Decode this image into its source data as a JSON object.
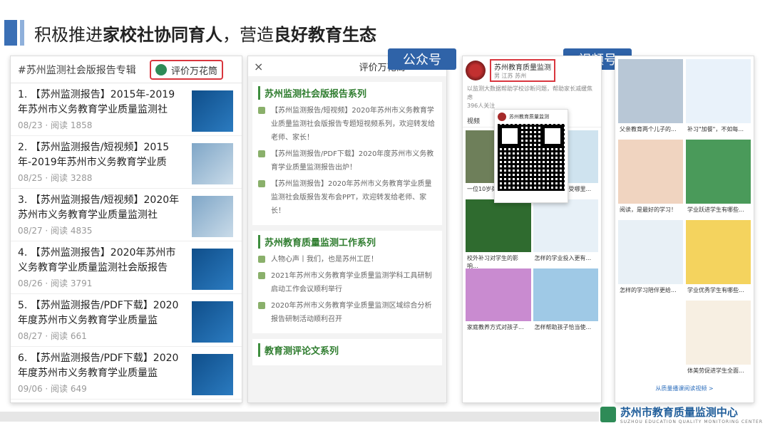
{
  "slide": {
    "title_plain1": "积极推进",
    "title_bold1": "家校社协同育人",
    "title_plain2": "，营造",
    "title_bold2": "良好教育生态"
  },
  "wechat_list": {
    "hashtag": "#苏州监测社会版报告专辑",
    "tag_label": "评价万花筒",
    "articles": [
      {
        "title": "1. 【苏州监测报告】2015年-2019年苏州市义务教育学业质量监测社",
        "meta": "08/23 · 阅读 1858"
      },
      {
        "title": "2. 【苏州监测报告/短视频】2015年-2019年苏州市义务教育学业质",
        "meta": "08/25 · 阅读 3288"
      },
      {
        "title": "3. 【苏州监测报告/短视频】2020年苏州市义务教育学业质量监测社",
        "meta": "08/27 · 阅读 4835"
      },
      {
        "title": "4. 【苏州监测报告】2020年苏州市义务教育学业质量监测社会版报告",
        "meta": "08/26 · 阅读 3791"
      },
      {
        "title": "5. 【苏州监测报告/PDF下载】2020年度苏州市义务教育学业质量监",
        "meta": "08/27 · 阅读 661"
      },
      {
        "title": "6. 【苏州监测报告/PDF下载】2020年度苏州市义务教育学业质量监",
        "meta": "09/06 · 阅读 649"
      }
    ]
  },
  "account_menu": {
    "close_icon": "×",
    "name": "评价万花筒",
    "series": [
      {
        "title": "苏州监测社会版报告系列",
        "items": [
          "【苏州监测报告/短视频】2020年苏州市义务教育学业质量监测社会版报告专题短视频系列，欢迎转发给老师、家长！",
          "【苏州监测报告/PDF下载】2020年度苏州市义务教育学业质量监测报告出炉！",
          "【苏州监测报告】2020年苏州市义务教育学业质量监测社会版报告发布会PPT，欢迎转发给老师、家长！"
        ]
      },
      {
        "title": "苏州教育质量监测工作系列",
        "items": [
          "人物心声丨我们，也是苏州工匠！",
          "2021年苏州市义务教育学业质量监测学科工具研制启动工作会议顺利举行",
          "2020年苏州市义务教育学业质量监测区域综合分析报告研制活动顺利召开"
        ]
      },
      {
        "title": "教育测评论文系列",
        "items": []
      }
    ]
  },
  "callouts": {
    "gzh": "公众号",
    "sph": "视频号"
  },
  "video_channel": {
    "name": "苏州教育质量监测",
    "location": "男 江苏 苏州",
    "desc": "以监测大数据帮助学校诊断问题，帮助家长减缓焦虑",
    "followers": "396人关注",
    "tab": "视频",
    "qr_title": "苏州教育质量监测",
    "videos": [
      {
        "caption": "一位10岁荷兰小女孩...",
        "color": "#6e7f5a"
      },
      {
        "caption": "孩子的压力感受哪里...",
        "color": "#cfe3ef"
      },
      {
        "caption": "校外补习对学生的影响...",
        "color": "#2f6b2f"
      },
      {
        "caption": "怎样的学业投入更有...",
        "color": "#e7f0f7"
      },
      {
        "caption": "家庭教养方式对孩子...",
        "color": "#c98bd0"
      },
      {
        "caption": "怎样帮助孩子恰当使...",
        "color": "#9fc9e6"
      }
    ]
  },
  "channel_feed": {
    "col1": [
      {
        "caption": "父亲教育两个儿子的...",
        "color": "#b8c7d6"
      },
      {
        "caption": "阅读，是最好的学习！",
        "color": "#f0d4c0"
      },
      {
        "caption": "怎样的学习陪伴更给...",
        "color": "#e8f0f6"
      }
    ],
    "col2": [
      {
        "caption": "补习\"加餐\"，不如每...",
        "color": "#e9f2fa"
      },
      {
        "caption": "学业跃进学生有哪些...",
        "color": "#4a9a5a"
      },
      {
        "caption": "学业优秀学生有哪些...",
        "color": "#f4d35e"
      },
      {
        "caption": "体美劳促进学生全面...",
        "color": "#f7efe2"
      }
    ],
    "more": "从质量播课阅读视频 >"
  },
  "footer": {
    "org": "苏州市教育质量监测中心",
    "org_en": "SUZHOU EDUCATION QUALITY MONITORING CENTER"
  }
}
